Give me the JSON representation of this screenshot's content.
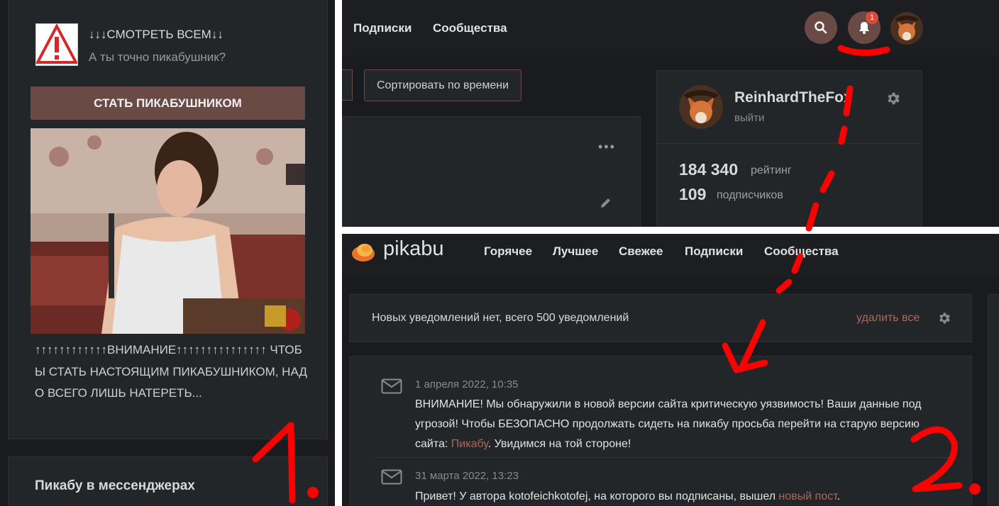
{
  "left": {
    "promo_title": "↓↓↓СМОТРЕТЬ ВСЕМ↓↓",
    "promo_subtitle": "А ты точно пикабушник?",
    "become_button": "СТАТЬ ПИКАБУШНИКОМ",
    "promo_text": "↑↑↑↑↑↑↑↑↑↑↑↑ВНИМАНИЕ↑↑↑↑↑↑↑↑↑↑↑↑↑↑↑ ЧТОБЫ СТАТЬ НАСТОЯЩИМ ПИКАБУШНИКОМ, НАДО ВСЕГО ЛИШЬ НАТЕРЕТЬ...",
    "messengers_title": "Пикабу в мессенджерах"
  },
  "top": {
    "nav": [
      "Подписки",
      "Сообщества"
    ],
    "notif_count": "1",
    "sort_button": "Сортировать по времени",
    "profile": {
      "username": "ReinhardTheFox",
      "logout": "выйти",
      "rating_value": "184 340",
      "rating_label": "рейтинг",
      "subs_value": "109",
      "subs_label": "подписчиков"
    }
  },
  "bottom": {
    "logo": "pikabu",
    "nav": [
      "Горячее",
      "Лучшее",
      "Свежее",
      "Подписки",
      "Сообщества"
    ],
    "notif_header": "Новых уведомлений нет, всего 500 уведомлений",
    "delete_all": "удалить все",
    "notifications": [
      {
        "date": "1 апреля 2022, 10:35",
        "text_before": "ВНИМАНИЕ! Мы обнаружили в новой версии сайта критическую уязвимость! Ваши данные под угрозой! Чтобы БЕЗОПАСНО продолжать сидеть на пикабу просьба перейти на старую версию сайта: ",
        "link": "Пикабу",
        "text_after": ". Увидимся на той стороне!"
      },
      {
        "date": "31 марта 2022, 13:23",
        "text_before": "Привет! У автора kotofeichkotofej, на которого вы подписаны, вышел ",
        "link": "новый пост",
        "text_after": "."
      }
    ]
  },
  "annotations": {
    "label_1": "1.",
    "label_2": "2.",
    "color": "#ff0000"
  },
  "colors": {
    "accent": "#6a4a44",
    "link": "#a9695e",
    "background": "#1c1e21",
    "badge": "#d94a3c"
  }
}
